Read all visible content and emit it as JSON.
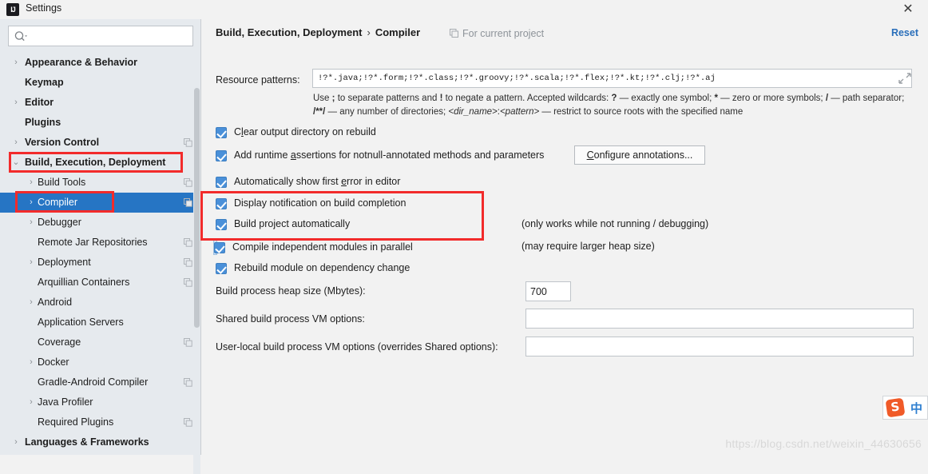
{
  "window": {
    "title": "Settings",
    "app_icon": "intellij-idea-icon",
    "close_icon": "close-icon"
  },
  "sidebar": {
    "search": {
      "placeholder": "",
      "value": "",
      "icon": "search-icon"
    },
    "items": [
      {
        "label": "Appearance & Behavior",
        "level": 0,
        "arrow": "›",
        "bold": true,
        "copy": false,
        "selected": false
      },
      {
        "label": "Keymap",
        "level": 0,
        "arrow": "",
        "bold": true,
        "copy": false,
        "selected": false
      },
      {
        "label": "Editor",
        "level": 0,
        "arrow": "›",
        "bold": true,
        "copy": false,
        "selected": false
      },
      {
        "label": "Plugins",
        "level": 0,
        "arrow": "",
        "bold": true,
        "copy": false,
        "selected": false
      },
      {
        "label": "Version Control",
        "level": 0,
        "arrow": "›",
        "bold": true,
        "copy": true,
        "selected": false
      },
      {
        "label": "Build, Execution, Deployment",
        "level": 0,
        "arrow": "⌄",
        "bold": true,
        "copy": false,
        "selected": false
      },
      {
        "label": "Build Tools",
        "level": 1,
        "arrow": "›",
        "bold": false,
        "copy": true,
        "selected": false
      },
      {
        "label": "Compiler",
        "level": 1,
        "arrow": "›",
        "bold": false,
        "copy": true,
        "selected": true
      },
      {
        "label": "Debugger",
        "level": 1,
        "arrow": "›",
        "bold": false,
        "copy": false,
        "selected": false
      },
      {
        "label": "Remote Jar Repositories",
        "level": 1,
        "arrow": "",
        "bold": false,
        "copy": true,
        "selected": false
      },
      {
        "label": "Deployment",
        "level": 1,
        "arrow": "›",
        "bold": false,
        "copy": true,
        "selected": false
      },
      {
        "label": "Arquillian Containers",
        "level": 1,
        "arrow": "",
        "bold": false,
        "copy": true,
        "selected": false
      },
      {
        "label": "Android",
        "level": 1,
        "arrow": "›",
        "bold": false,
        "copy": false,
        "selected": false
      },
      {
        "label": "Application Servers",
        "level": 1,
        "arrow": "",
        "bold": false,
        "copy": false,
        "selected": false
      },
      {
        "label": "Coverage",
        "level": 1,
        "arrow": "",
        "bold": false,
        "copy": true,
        "selected": false
      },
      {
        "label": "Docker",
        "level": 1,
        "arrow": "›",
        "bold": false,
        "copy": false,
        "selected": false
      },
      {
        "label": "Gradle-Android Compiler",
        "level": 1,
        "arrow": "",
        "bold": false,
        "copy": true,
        "selected": false
      },
      {
        "label": "Java Profiler",
        "level": 1,
        "arrow": "›",
        "bold": false,
        "copy": false,
        "selected": false
      },
      {
        "label": "Required Plugins",
        "level": 1,
        "arrow": "",
        "bold": false,
        "copy": true,
        "selected": false
      },
      {
        "label": "Languages & Frameworks",
        "level": 0,
        "arrow": "›",
        "bold": true,
        "copy": false,
        "selected": false
      }
    ]
  },
  "header": {
    "breadcrumb_root": "Build, Execution, Deployment",
    "breadcrumb_separator": "›",
    "breadcrumb_leaf": "Compiler",
    "scope_label": "For current project",
    "scope_icon": "copy-scope-icon",
    "reset_label": "Reset"
  },
  "main": {
    "resource_patterns": {
      "label": "Resource patterns:",
      "value": "!?*.java;!?*.form;!?*.class;!?*.groovy;!?*.scala;!?*.flex;!?*.kt;!?*.clj;!?*.aj",
      "placeholder": "",
      "expand_icon": "expand-icon"
    },
    "hint_line1_pre": "Use ",
    "hint_semicolon": ";",
    "hint_line1_mid": " to separate patterns and ",
    "hint_bang": "!",
    "hint_line1_post": " to negate a pattern. Accepted wildcards: ",
    "hint_q": "?",
    "hint_q_desc": " — exactly one symbol; ",
    "hint_star": "*",
    "hint_star_desc": " — zero or more symbols; ",
    "hint_slash": "/",
    "hint_slash_desc": " — path separator; ",
    "hint_globstar": "/**/",
    "hint_globstar_desc": " — any number of directories;  ",
    "hint_dirname": "<dir_name>",
    "hint_colon": ":",
    "hint_pattern": "<pattern>",
    "hint_tail": " — restrict to source roots with the specified name",
    "checkboxes": [
      {
        "label_pre": "C",
        "label_mn": "l",
        "label_post": "ear output directory on rebuild",
        "checked": true,
        "focused": false,
        "note": ""
      },
      {
        "label_pre": "Add runtime ",
        "label_mn": "a",
        "label_post": "ssertions for notnull-annotated methods and parameters",
        "checked": true,
        "focused": false,
        "note": ""
      },
      {
        "label_pre": "Automatically show first ",
        "label_mn": "e",
        "label_post": "rror in editor",
        "checked": true,
        "focused": false,
        "note": ""
      },
      {
        "label_pre": "Display notification on build completion",
        "label_mn": "",
        "label_post": "",
        "checked": true,
        "focused": false,
        "note": ""
      },
      {
        "label_pre": "Build project automatically",
        "label_mn": "",
        "label_post": "",
        "checked": true,
        "focused": false,
        "note": "(only works while not running / debugging)"
      },
      {
        "label_pre": "Compile independent modules in parallel",
        "label_mn": "",
        "label_post": "",
        "checked": true,
        "focused": true,
        "note": "(may require larger heap size)"
      },
      {
        "label_pre": "Rebuild module on dependency change",
        "label_mn": "",
        "label_post": "",
        "checked": true,
        "focused": false,
        "note": ""
      }
    ],
    "configure_annotations": {
      "label_pre": "",
      "label_mn": "C",
      "label_post": "onfigure annotations..."
    },
    "heap": {
      "label": "Build process heap size (Mbytes):",
      "value": "700",
      "placeholder": ""
    },
    "shared_vm": {
      "label": "Shared build process VM options:",
      "value": "",
      "placeholder": ""
    },
    "user_vm": {
      "label": "User-local build process VM options (overrides Shared options):",
      "value": "",
      "placeholder": ""
    }
  },
  "overlay": {
    "ime_logo": "sogou-icon",
    "ime_mode": "中",
    "watermark": "https://blog.csdn.net/weixin_44630656"
  },
  "colors": {
    "selection_blue": "#2675c4",
    "accent_link": "#2a6fba",
    "annotation_red": "#f22b2b",
    "checkbox_blue": "#4a90d9"
  }
}
